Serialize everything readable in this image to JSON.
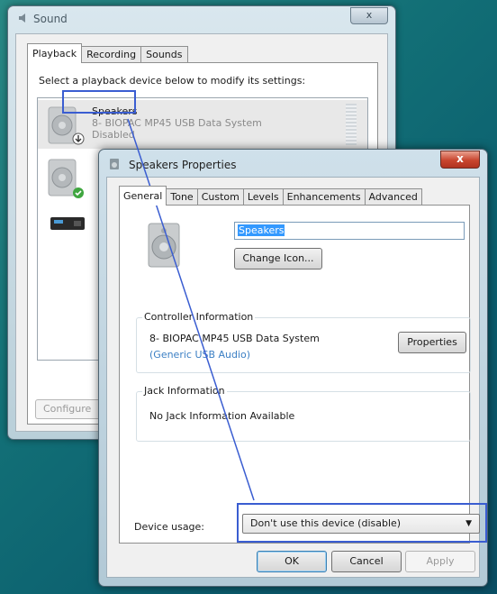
{
  "sound_window": {
    "title": "Sound",
    "close_label": "x",
    "tabs": [
      "Playback",
      "Recording",
      "Sounds"
    ],
    "instruction": "Select a playback device below to modify its settings:",
    "devices": [
      {
        "name": "Speakers",
        "description": "8- BIOPAC MP45 USB Data System",
        "status": "Disabled"
      }
    ],
    "configure_label": "Configure"
  },
  "props_window": {
    "title": "Speakers Properties",
    "close_label": "x",
    "tabs": [
      "General",
      "Tone",
      "Custom",
      "Levels",
      "Enhancements",
      "Advanced"
    ],
    "name_value": "Speakers",
    "change_icon_label": "Change Icon...",
    "controller_group_label": "Controller Information",
    "controller_name": "8- BIOPAC MP45 USB Data System",
    "controller_sub": "(Generic USB Audio)",
    "properties_label": "Properties",
    "jack_group_label": "Jack Information",
    "jack_text": "No Jack Information Available",
    "device_usage_label": "Device usage:",
    "device_usage_value": "Don't use this device (disable)",
    "ok_label": "OK",
    "cancel_label": "Cancel",
    "apply_label": "Apply"
  },
  "colors": {
    "callout": "#3a5dd1",
    "desktop": "#126f76",
    "link": "#3b7fc4",
    "close_red": "#c8452e"
  }
}
